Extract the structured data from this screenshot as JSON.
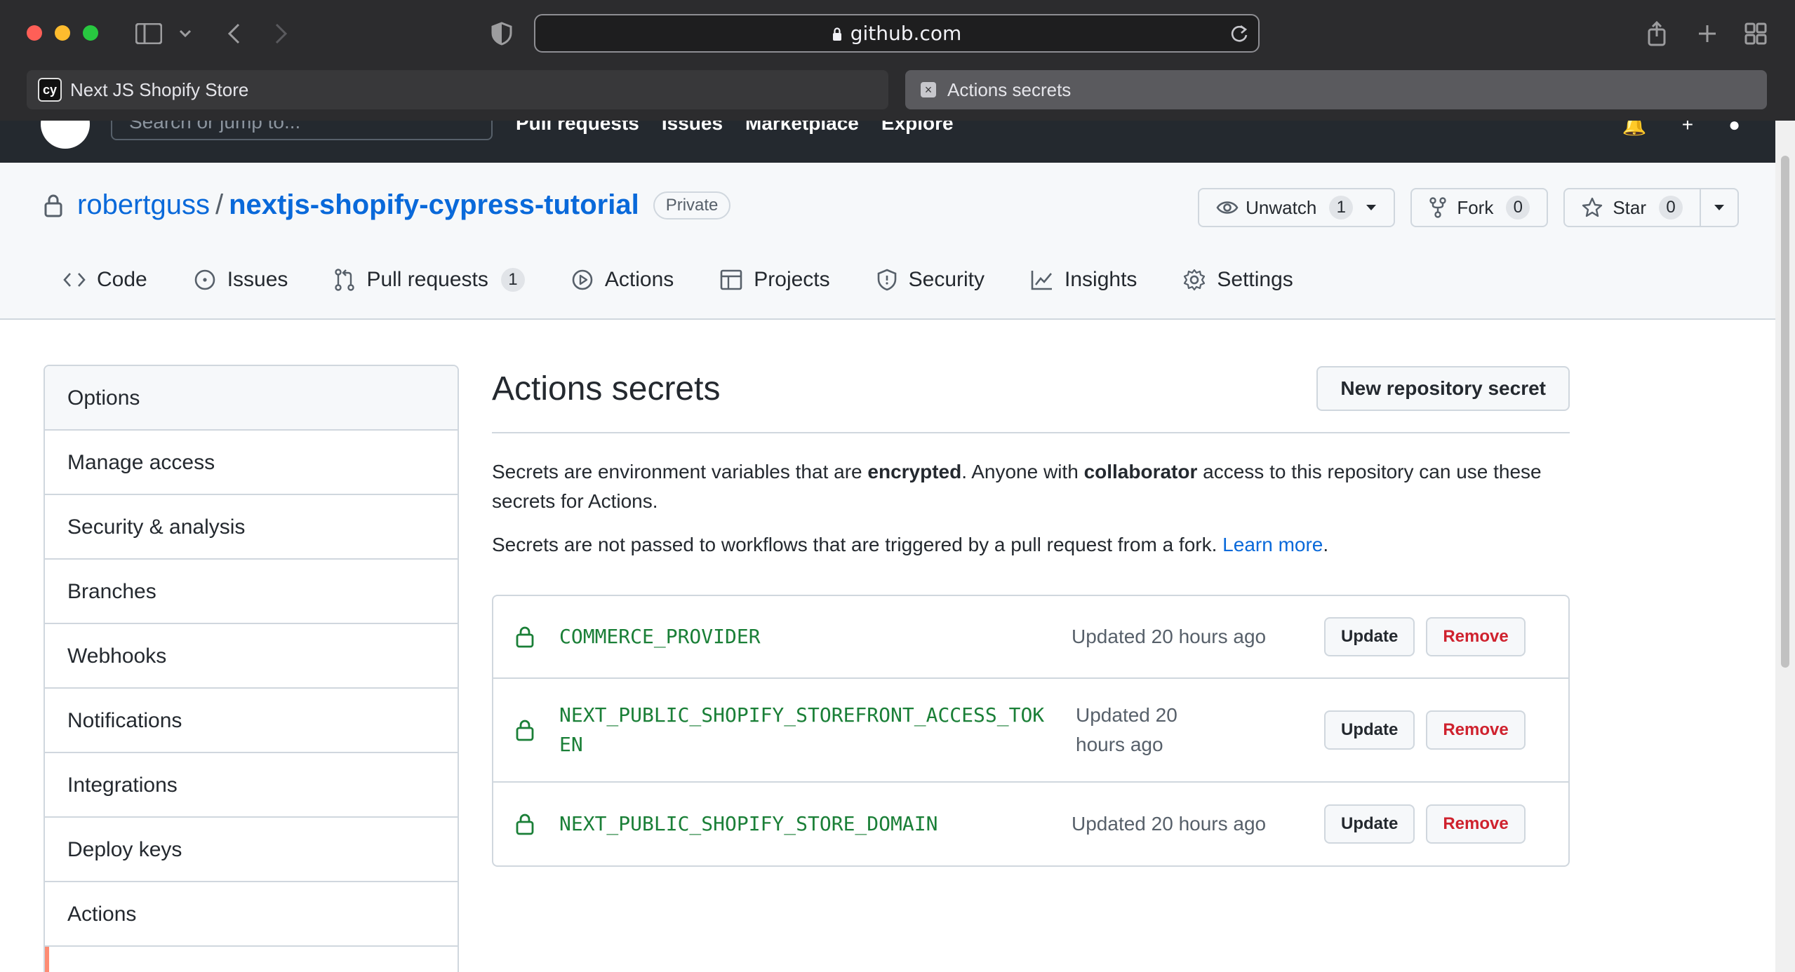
{
  "browser": {
    "address": "github.com",
    "tabs": [
      {
        "label": "Next JS Shopify Store",
        "favicon": "cy"
      },
      {
        "label": "Actions secrets"
      }
    ]
  },
  "gh_header": {
    "search_placeholder": "Search or jump to...",
    "search_shortcut": "/",
    "nav": [
      "Pull requests",
      "Issues",
      "Marketplace",
      "Explore"
    ]
  },
  "repo": {
    "owner": "robertguss",
    "separator": "/",
    "name": "nextjs-shopify-cypress-tutorial",
    "visibility": "Private",
    "watch_label": "Unwatch",
    "watch_count": "1",
    "fork_label": "Fork",
    "fork_count": "0",
    "star_label": "Star",
    "star_count": "0",
    "tabs": [
      {
        "label": "Code",
        "icon": "code-icon"
      },
      {
        "label": "Issues",
        "icon": "issue-icon"
      },
      {
        "label": "Pull requests",
        "icon": "pull-request-icon",
        "count": "1"
      },
      {
        "label": "Actions",
        "icon": "play-icon"
      },
      {
        "label": "Projects",
        "icon": "table-icon"
      },
      {
        "label": "Security",
        "icon": "shield-icon"
      },
      {
        "label": "Insights",
        "icon": "graph-icon"
      },
      {
        "label": "Settings",
        "icon": "gear-icon"
      }
    ]
  },
  "sidebar": {
    "items": [
      "Options",
      "Manage access",
      "Security & analysis",
      "Branches",
      "Webhooks",
      "Notifications",
      "Integrations",
      "Deploy keys",
      "Actions"
    ]
  },
  "main": {
    "title": "Actions secrets",
    "new_button": "New repository secret",
    "desc1_a": "Secrets are environment variables that are ",
    "desc1_b": "encrypted",
    "desc1_c": ". Anyone with ",
    "desc1_d": "collaborator",
    "desc1_e": " access to this repository can use these secrets for Actions.",
    "desc2_a": "Secrets are not passed to workflows that are triggered by a pull request from a fork. ",
    "desc2_link": "Learn more",
    "desc2_end": ".",
    "update_label": "Update",
    "remove_label": "Remove",
    "secrets": [
      {
        "name": "COMMERCE_PROVIDER",
        "updated": "Updated 20 hours ago"
      },
      {
        "name": "NEXT_PUBLIC_SHOPIFY_STOREFRONT_ACCESS_TOKEN",
        "updated": "Updated 20 hours ago"
      },
      {
        "name": "NEXT_PUBLIC_SHOPIFY_STORE_DOMAIN",
        "updated": "Updated 20 hours ago"
      }
    ]
  },
  "colors": {
    "accent_link": "#0969da",
    "secret_green": "#1a7f37",
    "danger": "#cf222e",
    "active_tab_marker": "#fd8c73"
  }
}
